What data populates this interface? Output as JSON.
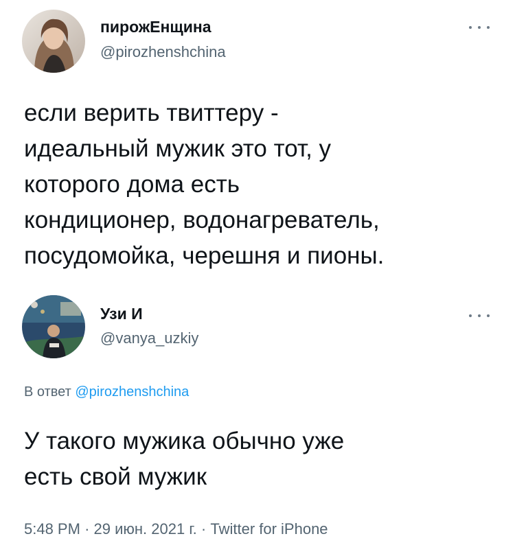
{
  "tweet": {
    "author": {
      "display_name": "пирожЕнщина",
      "handle": "@pirozhenshchina",
      "avatar_icon": "avatar-photo-woman"
    },
    "text": "если верить твиттеру -\nидеальный мужик это тот, у\nкоторого дома есть\nкондиционер, водонагреватель,\nпосудомойка, черешня и пионы."
  },
  "reply": {
    "author": {
      "display_name": "Узи И",
      "handle": "@vanya_uzkiy",
      "avatar_icon": "avatar-photo-man"
    },
    "reply_prefix": "В ответ",
    "reply_to": "@pirozhenshchina",
    "text": "У такого мужика обычно уже\nесть свой мужик",
    "time": "5:48 PM",
    "date": "29 июн. 2021 г.",
    "source": "Twitter for iPhone",
    "separator": "·"
  },
  "icons": {
    "more": "more-horizontal-icon"
  },
  "colors": {
    "text": "#0f1419",
    "secondary": "#536471",
    "link": "#1d9bf0"
  }
}
